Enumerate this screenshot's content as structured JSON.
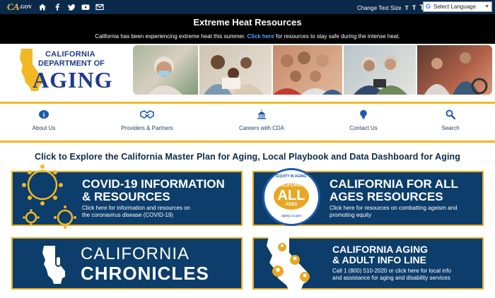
{
  "topbar": {
    "logo_text": "CA",
    "logo_sub": ".GOV",
    "icons": [
      "home-icon",
      "facebook-icon",
      "twitter-icon",
      "youtube-icon",
      "email-icon"
    ],
    "text_size_label": "Change Text Size",
    "text_size_options": [
      "T",
      "T",
      "T"
    ],
    "language_label": "Select Language"
  },
  "alert": {
    "title": "Extreme Heat Resources",
    "message_before": "California has been experiencing extreme heat this summer.",
    "link": "Click here",
    "message_after": "for resources to stay safe during the intense heat."
  },
  "brand": {
    "line1": "CALIFORNIA",
    "line2": "DEPARTMENT OF",
    "line3": "AGING"
  },
  "nav": {
    "items": [
      {
        "label": "About Us",
        "icon": "info-icon"
      },
      {
        "label": "Providers & Partners",
        "icon": "handshake-icon"
      },
      {
        "label": "Careers with CDA",
        "icon": "capitol-icon"
      },
      {
        "label": "Contact Us",
        "icon": "lightbulb-icon"
      },
      {
        "label": "Search",
        "icon": "search-icon"
      }
    ]
  },
  "explore_heading": "Click to Explore the California Master Plan for Aging, Local Playbook and Data Dashboard for Aging",
  "cards": {
    "covid": {
      "title_line1": "COVID-19 INFORMATION",
      "title_line2": "& RESOURCES",
      "desc_line1": "Click here for information and resources on",
      "desc_line2": "the coronavirus disease (COVID-19)"
    },
    "all_ages": {
      "badge_top": "EQUITY IN AGING",
      "badge_mid": "CALIFORNIA",
      "badge_big": "ALL",
      "badge_sub": "AGES",
      "badge_url": "aging.ca.gov",
      "title_line1": "CALIFORNIA FOR ALL",
      "title_line2": "AGES RESOURCES",
      "desc_line1": "Click here for resources on combatting ageism and",
      "desc_line2": "promoting equity"
    },
    "chronicles": {
      "line1": "CALIFORNIA",
      "line2": "CHRONICLES"
    },
    "info_line": {
      "title_line1": "CALIFORNIA AGING",
      "title_line2": "& ADULT INFO LINE",
      "desc_line1": "Call 1 (800) 510-2020 or click here for local info",
      "desc_line2": "and assistance for aging and disability services"
    }
  },
  "colors": {
    "navy": "#0c3d6b",
    "gold": "#e9a823",
    "topbar": "#0b2a4a",
    "link": "#4fa3ff"
  }
}
